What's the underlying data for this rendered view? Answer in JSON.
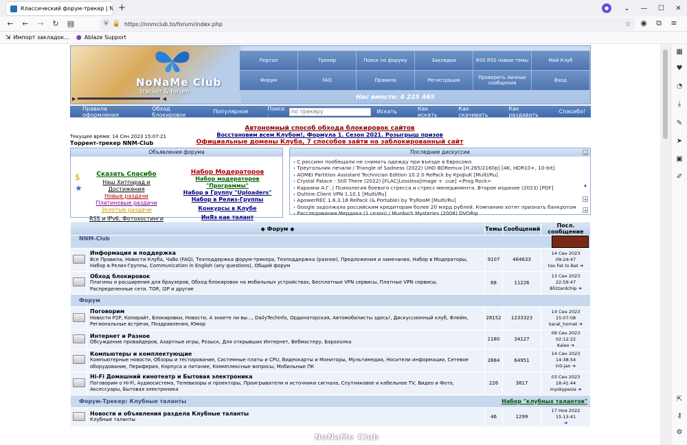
{
  "browser": {
    "tab_title": "Классический форум-трекер | N",
    "url": "https://nnmclub.to/forum/index.php",
    "bookmarks": [
      "Импорт закладок...",
      "Ablaze Support"
    ]
  },
  "site": {
    "logo_line1": "NoNaMe Club",
    "logo_line2": "tracker & forum",
    "menu": [
      "Портал",
      "Трекер",
      "Поиск по форуму",
      "Закладки",
      "RSS RSS новые темы",
      "Мой Клуб",
      "Форум",
      "FAQ",
      "Правила",
      "Регистрация",
      "Проверить личные сообщения",
      "Вход"
    ],
    "together": "Нас вместе: 4 225 465",
    "nav": {
      "rules": "Правила оформления",
      "bypass": "Обход блокировок",
      "popular": "Популярное",
      "search_label": "Поиск :",
      "search_placeholder": "по трекеру",
      "search_btn": "Искать",
      "howsearch": "Как искать",
      "howdownload": "Как скачивать",
      "howdistribute": "Как раздавать",
      "thanks": "Спасибо!"
    },
    "announce": {
      "a1": "Автономный способ обхода блокировок сайтов",
      "a2": "Восстановим всем Клубом!, Формула 1. Сезон 2021. Розыгрыш призов",
      "a3": "Официальные домены Клуба, 7 способов зайти на заблокированный сайт"
    },
    "current_time": "Текущее время: 14 Сен 2023 15:07:21",
    "tracker_title": "Торрент-трекер NNM-Club"
  },
  "ads": {
    "title": "Объявления форума",
    "left": [
      "Сказать Спасибо",
      "Наш Хитпарад и Достижения",
      "Новые раздачи",
      "Платиновые раздачи",
      "Золотые раздачи",
      "RSS и IPv6, Фотохостинги"
    ],
    "right": [
      "Набор Модераторов",
      "Набор модераторов \"Программы\"",
      "Набор в Группу \"Uploaders\"",
      "Набор в Релиз-Группы",
      "Конкурсы в Клубе",
      "ИнЯз как талант"
    ]
  },
  "discussions": {
    "title": "Последние дискуссии",
    "items": [
      "С россиян пообещали не снимать одежду при въезде в Евросоюз",
      "Треугольник печали / Triangle of Sadness (2022) UHD BDRemux [H.265/2160p] [4K, HDR10+, 10-bit]",
      "AOMEI Partition Assistant Technician Edition 10.2.0 RePack by KpoJIuK [Multi/Ru]",
      "Crystal Palace - Still There (2022) [FLAC|Lossless|image + .cue] <Prog Rock>",
      "Караяни А.Г. | Психология боевого стресса и стресс-менеджмента. Второе издание (2023) [PDF]",
      "Outline Client VPN 1.10.1 [Multi/Ru]",
      "ApowerREC 1.6.3.18 RePack (& Portable) by TryRooM [Multi/Ru]",
      "Google задолжала российским кредиторам более 20 млрд рублей. Компанию хотят признать банкротом",
      "Расследования Мердока (1 сезон) / Murdoch Mysteries (2008) DVDRip"
    ]
  },
  "forum": {
    "col_forum": "Форум",
    "col_topics": "Темы",
    "col_posts": "Сообщений",
    "col_last": "Посл. сообщение",
    "cat1": "NNM-Club",
    "cat2": "Форум",
    "cat3": "Форум-Трекер: Клубные таланты",
    "cat3_link": "Набор \"клубных талантов\"",
    "rows": [
      {
        "title": "Информация и поддержка",
        "subs": "Все Правила, Новости Клуба, ЧаВо (FAQ), Техподдержка форум-трекера, Техподдержка (разное), Предложения и замечания, Набор в Модераторы, Набор в Релиз-Группы, Communication in English (any questions), Общий форум",
        "topics": "9107",
        "posts": "464633",
        "last_date": "14 Сен 2023 09:24:47",
        "last_user": "too Fat to Bat"
      },
      {
        "title": "Обход блокировок",
        "subs": "Плагины и расширения для браузеров, Обход блокировок на мобильных устройствах, Бесплатные VPN сервисы, Платные VPN сервисы, Распределенные сети. TOR, I2P и другие",
        "topics": "88",
        "posts": "11226",
        "last_date": "13 Сен 2023 22:59:47",
        "last_user": "Blizzardchip"
      },
      {
        "title": "Поговорим",
        "subs": "Новости P2P, Копирайт, Блокировки, Новости, А знаете ли вы..., DailyTechInfo, Ординаторская, Автомобилисты здесь!, Дискуссионный клуб, Флейм, Региональные встречи, Поздравления, Юмор",
        "topics": "28152",
        "posts": "1233323",
        "last_date": "14 Сен 2023 15:07:08",
        "last_user": "karat_hornet"
      },
      {
        "title": "Интернет и Разное",
        "subs": "Обсуждение провайдеров, Азартные игры, Розыск, Для открывших Интернет, Вебмастеру, Барахолка",
        "topics": "1180",
        "posts": "34127",
        "last_date": "09 Сен 2023 02:12:22",
        "last_user": "Kalex"
      },
      {
        "title": "Компьютеры и комплектующие",
        "subs": "Компьютерные новости, Обзоры и тестирование, Системные платы и CPU, Видеокарты и Мониторы, Мультимедиа, Носители информации, Сетевое оборудование, Периферия, Корпуса и питание, Коммплексные вопросы, Мобильные ПК",
        "topics": "2884",
        "posts": "64951",
        "last_date": "14 Сен 2023 14:38:54",
        "last_user": "tr0-jan"
      },
      {
        "title": "Hi-Fi Домашний кинотеатр и Бытовая электроника",
        "subs": "Поговорим о Hi-Fi, Аудиосистема, Телевизоры и проекторы, Проигрыватели и источники сигнала, Спутниковое и кабельное TV, Видео и Фото, Аксессуары, Бытовая электроника",
        "topics": "226",
        "posts": "3817",
        "last_date": "03 Сен 2023 18:41:44",
        "last_user": "myskypesla"
      },
      {
        "title": "Новости и объявления раздела Клубные таланты",
        "subs": "Клубные таланты",
        "topics": "46",
        "posts": "1299",
        "last_date": "17 Ноя 2022 15:13:41",
        "last_user": ""
      }
    ]
  }
}
